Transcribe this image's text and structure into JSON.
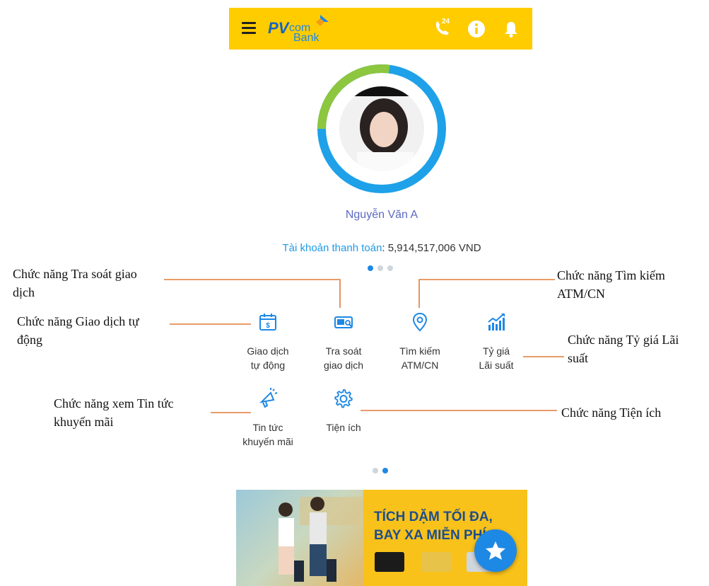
{
  "header": {
    "logo_pv": "PV",
    "logo_com": "com",
    "logo_bank": "Bank",
    "hotline_badge": "24",
    "icons": [
      "menu-icon",
      "phone-24-icon",
      "info-icon",
      "bell-icon"
    ]
  },
  "profile": {
    "name": "Nguyễn Văn A",
    "account_label": "Tài khoản thanh toán",
    "account_sep": ": ",
    "account_value": "5,914,517,006 VND",
    "ring_progress": 0.27,
    "ring_colors": {
      "progress": "#8DC63F",
      "rest": "#1EA1E8"
    }
  },
  "pager_top": {
    "count": 3,
    "active": 0
  },
  "functions": [
    {
      "line1": "Giao dịch",
      "line2": "tự động",
      "icon": "calendar-dollar-icon"
    },
    {
      "line1": "Tra soát",
      "line2": "giao dịch",
      "icon": "search-card-icon"
    },
    {
      "line1": "Tìm kiếm",
      "line2": "ATM/CN",
      "icon": "location-pin-icon"
    },
    {
      "line1": "Tỷ giá",
      "line2": "Lãi suất",
      "icon": "chart-bar-icon"
    },
    {
      "line1": "Tin tức",
      "line2": "khuyến mãi",
      "icon": "megaphone-icon"
    },
    {
      "line1": "Tiện ích",
      "line2": "",
      "icon": "gear-icon"
    }
  ],
  "pager_bottom": {
    "count": 2,
    "active": 1
  },
  "annotations": {
    "tra_soat_1": "Chức năng Tra soát giao",
    "tra_soat_2": "dịch",
    "giao_dich_1": "Chức năng Giao dịch tự",
    "giao_dich_2": "động",
    "tin_tuc_1": "Chức năng xem Tin tức",
    "tin_tuc_2": "khuyến mãi",
    "tim_kiem_1": "Chức năng Tìm kiếm",
    "tim_kiem_2": "ATM/CN",
    "ty_gia_1": "Chức năng Tỷ giá Lãi",
    "ty_gia_2": "suất",
    "tien_ich": "Chức năng Tiện ích"
  },
  "banner": {
    "line1": "TÍCH DẶM TỐI ĐA,",
    "line2": "BAY XA MIỄN PHÍ"
  },
  "colors": {
    "brand_yellow": "#FFCC00",
    "brand_blue": "#1E88E5",
    "annotation_line": "#E07B39"
  }
}
